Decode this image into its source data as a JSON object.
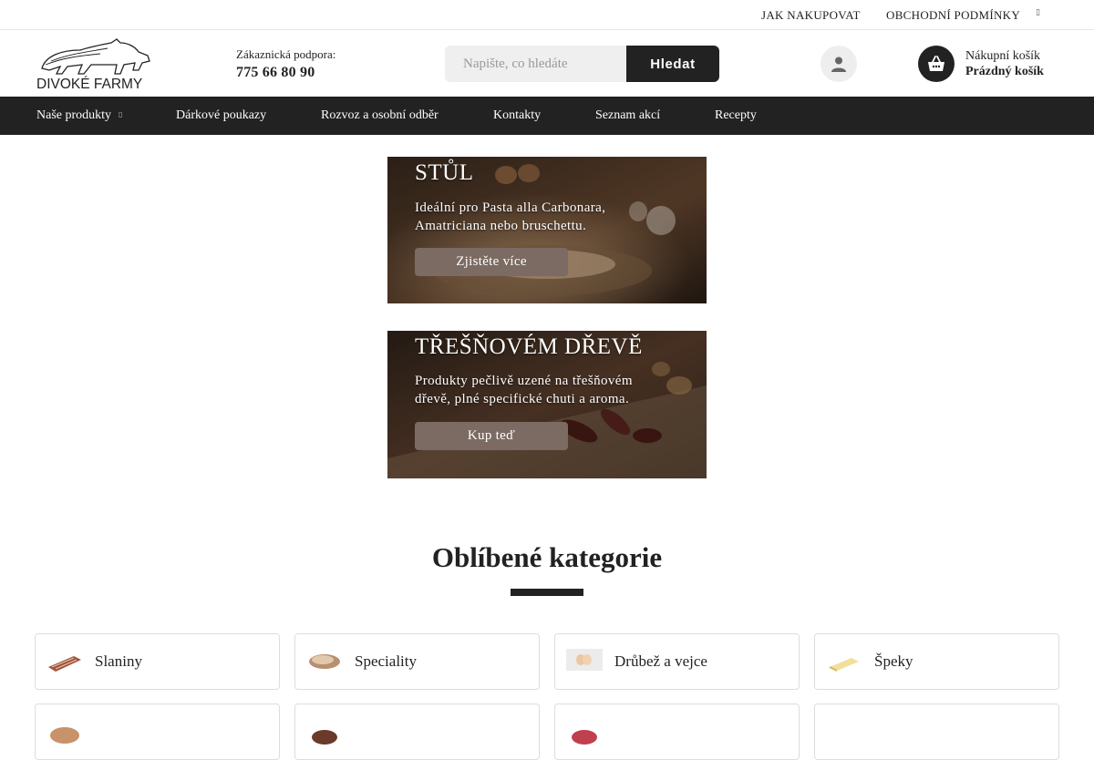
{
  "topbar": {
    "links": [
      "JAK NAKUPOVAT",
      "OBCHODNÍ PODMÍNKY"
    ]
  },
  "header": {
    "logo_text": "DIVOKÉ FARMY",
    "support_label": "Zákaznická podpora:",
    "support_phone": "775 66 80 90",
    "search_placeholder": "Napište, co hledáte",
    "search_button": "Hledat",
    "account_icon": "user-icon",
    "cart_icon": "basket-icon",
    "cart_title": "Nákupní košík",
    "cart_status": "Prázdný košík"
  },
  "nav": {
    "items": [
      "Naše produkty",
      "Dárkové poukazy",
      "Rozvoz a osobní odběr",
      "Kontakty",
      "Seznam akcí",
      "Recepty"
    ]
  },
  "banners": [
    {
      "title": "STŮL",
      "text": "Ideální pro Pasta alla Carbonara, Amatriciana nebo bruschettu.",
      "button": "Zjistěte více"
    },
    {
      "title": "TŘEŠŇOVÉM DŘEVĚ",
      "text": "Produkty pečlivě uzené na třešňovém dřevě, plné specifické chuti a aroma.",
      "button": "Kup teď"
    }
  ],
  "categories": {
    "title": "Oblíbené kategorie",
    "items": [
      "Slaniny",
      "Speciality",
      "Drůbež a vejce",
      "Špeky"
    ]
  },
  "colors": {
    "dark": "#222222",
    "button_brown": "#7b6b62",
    "search_bg": "#efefef"
  }
}
